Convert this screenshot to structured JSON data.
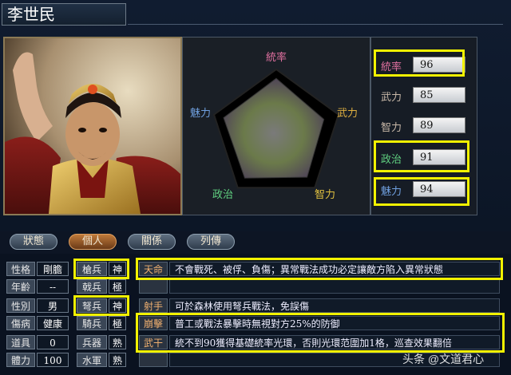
{
  "officer": {
    "name": "李世民"
  },
  "radar": {
    "labels": {
      "leadership": "統率",
      "war": "武力",
      "intellect": "智力",
      "politics": "政治",
      "charm": "魅力"
    },
    "values": [
      96,
      85,
      89,
      91,
      94
    ],
    "max": 100
  },
  "stats": [
    {
      "label": "統率",
      "value": "96"
    },
    {
      "label": "武力",
      "value": "85"
    },
    {
      "label": "智力",
      "value": "89"
    },
    {
      "label": "政治",
      "value": "91"
    },
    {
      "label": "魅力",
      "value": "94"
    }
  ],
  "tabs": [
    "狀態",
    "個人",
    "關係",
    "列傳"
  ],
  "personal": [
    {
      "label": "性格",
      "value": "剛膽"
    },
    {
      "label": "年齡",
      "value": "--"
    },
    {
      "label": "性別",
      "value": "男"
    },
    {
      "label": "傷病",
      "value": "健康"
    },
    {
      "label": "道具",
      "value": "0"
    },
    {
      "label": "體力",
      "value": "100"
    }
  ],
  "aptitudes": [
    {
      "label": "槍兵",
      "value": "神"
    },
    {
      "label": "戟兵",
      "value": "極"
    },
    {
      "label": "弩兵",
      "value": "神"
    },
    {
      "label": "騎兵",
      "value": "極"
    },
    {
      "label": "兵器",
      "value": "熟"
    },
    {
      "label": "水軍",
      "value": "熟"
    }
  ],
  "skills": [
    {
      "name": "天命",
      "desc": "不會戰死、被俘、負傷；異常戰法成功必定讓敵方陷入異常狀態"
    },
    {
      "name": "",
      "desc": ""
    },
    {
      "name": "射手",
      "desc": "可於森林使用弩兵戰法，免誤傷"
    },
    {
      "name": "崩擊",
      "desc": "普工或戰法暴擊時無視對方25%的防御"
    },
    {
      "name": "武干",
      "desc": "統不到90獲得基礎統率光環，否則光環范圍加1格，巡查效果翻倍"
    },
    {
      "name": "",
      "desc": ""
    }
  ],
  "watermark": "头条 @文道君心",
  "colors": {
    "highlight": "#f2f200",
    "tab_active": "#c07a3a"
  }
}
